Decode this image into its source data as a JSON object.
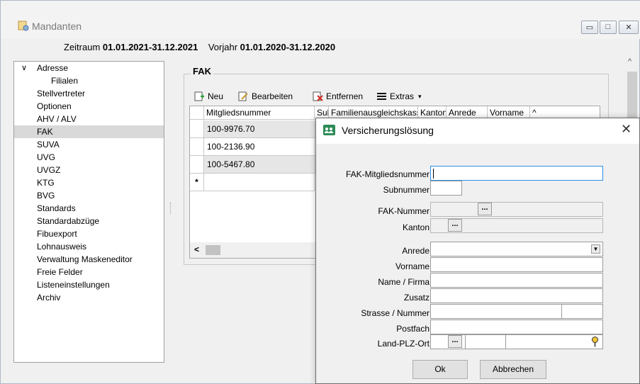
{
  "window": {
    "title": "Mandanten",
    "min_symbol": "▭",
    "max_symbol": "□",
    "close_symbol": "✕"
  },
  "period": {
    "label": "Zeitraum",
    "value": "01.01.2021-31.12.2021",
    "prev_label": "Vorjahr",
    "prev_value": "01.01.2020-31.12.2020"
  },
  "sidebar": {
    "items": [
      {
        "label": "Adresse"
      },
      {
        "label": "Filialen"
      },
      {
        "label": "Stellvertreter"
      },
      {
        "label": "Optionen"
      },
      {
        "label": "AHV / ALV"
      },
      {
        "label": "FAK"
      },
      {
        "label": "SUVA"
      },
      {
        "label": "UVG"
      },
      {
        "label": "UVGZ"
      },
      {
        "label": "KTG"
      },
      {
        "label": "BVG"
      },
      {
        "label": "Standards"
      },
      {
        "label": "Standardabzüge"
      },
      {
        "label": "Fibuexport"
      },
      {
        "label": "Lohnausweis"
      },
      {
        "label": "Verwaltung Maskeneditor"
      },
      {
        "label": "Freie Felder"
      },
      {
        "label": "Listeneinstellungen"
      },
      {
        "label": "Archiv"
      }
    ],
    "selected": "FAK"
  },
  "group": {
    "title": "FAK"
  },
  "toolbar": {
    "new": "Neu",
    "edit": "Bearbeiten",
    "remove": "Entfernen",
    "extras": "Extras",
    "extras_arrow": "▾"
  },
  "grid": {
    "columns": [
      "Mitgliedsnummer",
      "Sul",
      "FamilienausgleichskasseN",
      "Kanton",
      "Anrede",
      "Vorname"
    ],
    "rows": [
      {
        "number": "100-9976.70"
      },
      {
        "number": "100-2136.90"
      },
      {
        "number": "100-5467.80"
      }
    ],
    "new_row_marker": "*",
    "scroll_left": "<",
    "scroll_up": "^"
  },
  "dialog": {
    "title": "Versicherungslösung",
    "close_symbol": "✕",
    "labels": {
      "fak_member": "FAK-Mitgliedsnummer",
      "subnumber": "Subnummer",
      "fak_number": "FAK-Nummer",
      "canton": "Kanton",
      "salutation": "Anrede",
      "firstname": "Vorname",
      "name": "Name / Firma",
      "addition": "Zusatz",
      "street": "Strasse / Nummer",
      "pobox": "Postfach",
      "country": "Land-PLZ-Ort"
    },
    "ellipsis": "...",
    "ok": "Ok",
    "cancel": "Abbrechen"
  },
  "colors": {
    "accent": "#2d8ee8",
    "selected_row": "#d9d9d9",
    "alt_row": "#e6e6e6"
  }
}
